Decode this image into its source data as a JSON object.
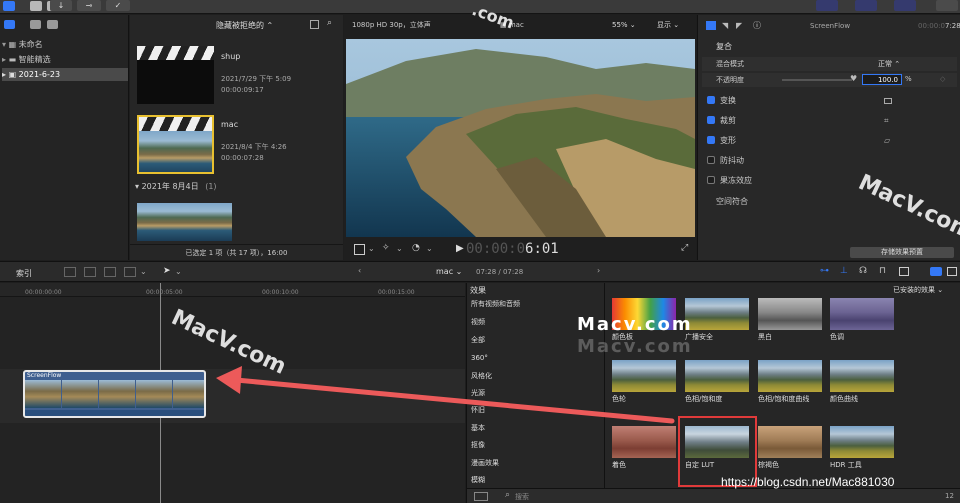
{
  "topbar": {
    "import_icon": "↓",
    "key_icon": "⊸",
    "check_icon": "✓"
  },
  "library": {
    "items": [
      {
        "label": "未命名"
      },
      {
        "label": "智能精选"
      },
      {
        "label": "2021-6-23"
      }
    ]
  },
  "browser": {
    "filter_label": "隐藏被拒绝的",
    "clips": [
      {
        "name": "shup",
        "date": "2021/7/29 下午 5:09",
        "duration": "00:00:09:17"
      },
      {
        "name": "mac",
        "date": "2021/8/4 下午 4:26",
        "duration": "00:00:07:28"
      }
    ],
    "group_header": "2021年 8月4日",
    "group_count": "(1)",
    "status": "已选定 1 项（共 17 项），16:00"
  },
  "viewer": {
    "format": "1080p HD 30p，立体声",
    "clip_name": "mac",
    "zoom": "55%",
    "display_label": "显示",
    "timecode": "6:01",
    "timecode_dim": "00:00:0"
  },
  "inspector": {
    "title": "ScreenFlow",
    "duration": "7:28",
    "duration_dim": "00:00:0",
    "section": "复合",
    "blend_label": "混合模式",
    "blend_value": "正常",
    "opacity_label": "不透明度",
    "opacity_value": "100.0",
    "opacity_unit": "%",
    "items": [
      {
        "label": "变换",
        "checked": true
      },
      {
        "label": "裁剪",
        "checked": true
      },
      {
        "label": "变形",
        "checked": true
      },
      {
        "label": "防抖动",
        "checked": false
      },
      {
        "label": "果冻效应",
        "checked": false
      }
    ],
    "spatial_label": "空间符合",
    "save_preset": "存储效果预置"
  },
  "timeline": {
    "index_label": "索引",
    "project_name": "mac",
    "project_time": "07:28 / 07:28",
    "ruler": [
      "00:00:00:00",
      "00:00:05:00",
      "00:00:10:00",
      "00:00:15:00"
    ],
    "clip_label": "ScreenFlow"
  },
  "effects": {
    "header": "效果",
    "installed": "已安装的效果",
    "categories": [
      "所有视频和音频",
      "视频",
      "全部",
      "360°",
      "风格化",
      "光源",
      "怀旧",
      "基本",
      "抠像",
      "漫画效果",
      "模糊"
    ],
    "items": [
      {
        "label": "颜色板"
      },
      {
        "label": "广播安全"
      },
      {
        "label": "黑白"
      },
      {
        "label": "色调"
      },
      {
        "label": "色轮"
      },
      {
        "label": "色相/饱和度"
      },
      {
        "label": "色相/饱和度曲线"
      },
      {
        "label": "颜色曲线"
      },
      {
        "label": "着色"
      },
      {
        "label": "自定 LUT"
      },
      {
        "label": "棕褐色"
      },
      {
        "label": "HDR 工具"
      }
    ],
    "search_placeholder": "搜索",
    "count": "12"
  },
  "overlays": {
    "watermarks": [
      "MacV.com",
      "MacV.com",
      "MacV.com",
      "Macv.com",
      "Macv.com",
      "Mac",
      ".com"
    ],
    "csdn": "https://blog.csdn.net/Mac881030"
  },
  "colors": {
    "accent": "#3478f6",
    "selection_yellow": "#e8c030",
    "highlight_red": "#e03a3a",
    "arrow_red": "#ec5a5a"
  }
}
